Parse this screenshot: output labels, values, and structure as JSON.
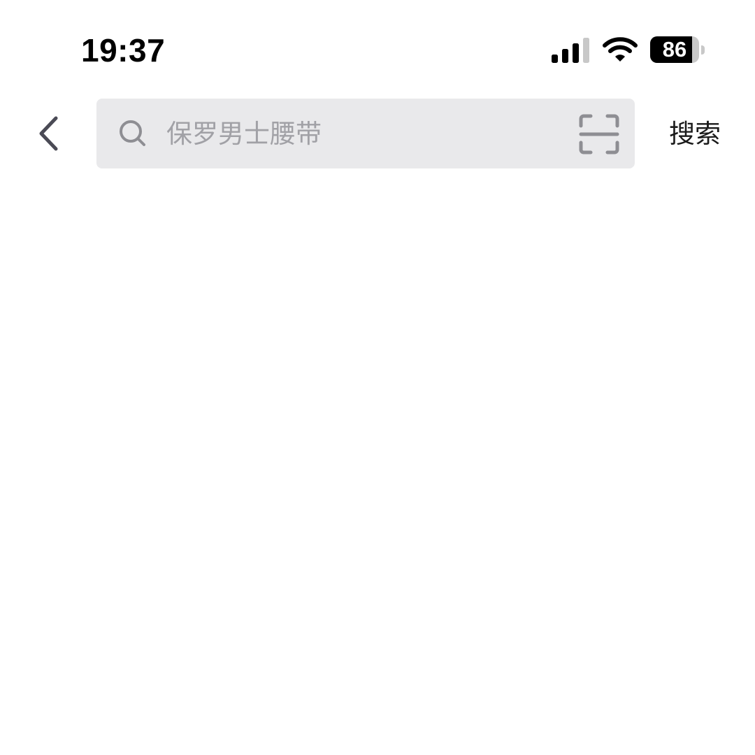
{
  "status_bar": {
    "time": "19:37",
    "battery_level": "86",
    "battery_fraction": 0.86,
    "icons": [
      "signal-icon",
      "wifi-icon",
      "battery-icon"
    ]
  },
  "header": {
    "back_icon": "chevron-left-icon",
    "search": {
      "value": "",
      "placeholder": "保罗男士腰带",
      "icon": "search-icon",
      "scan_icon": "scan-icon"
    },
    "search_button_label": "搜索"
  },
  "colors": {
    "search_box_bg": "#e9e9eb",
    "placeholder": "#a1a1a6",
    "icon_gray": "#8e8e93",
    "back_arrow": "#4a4a55"
  }
}
